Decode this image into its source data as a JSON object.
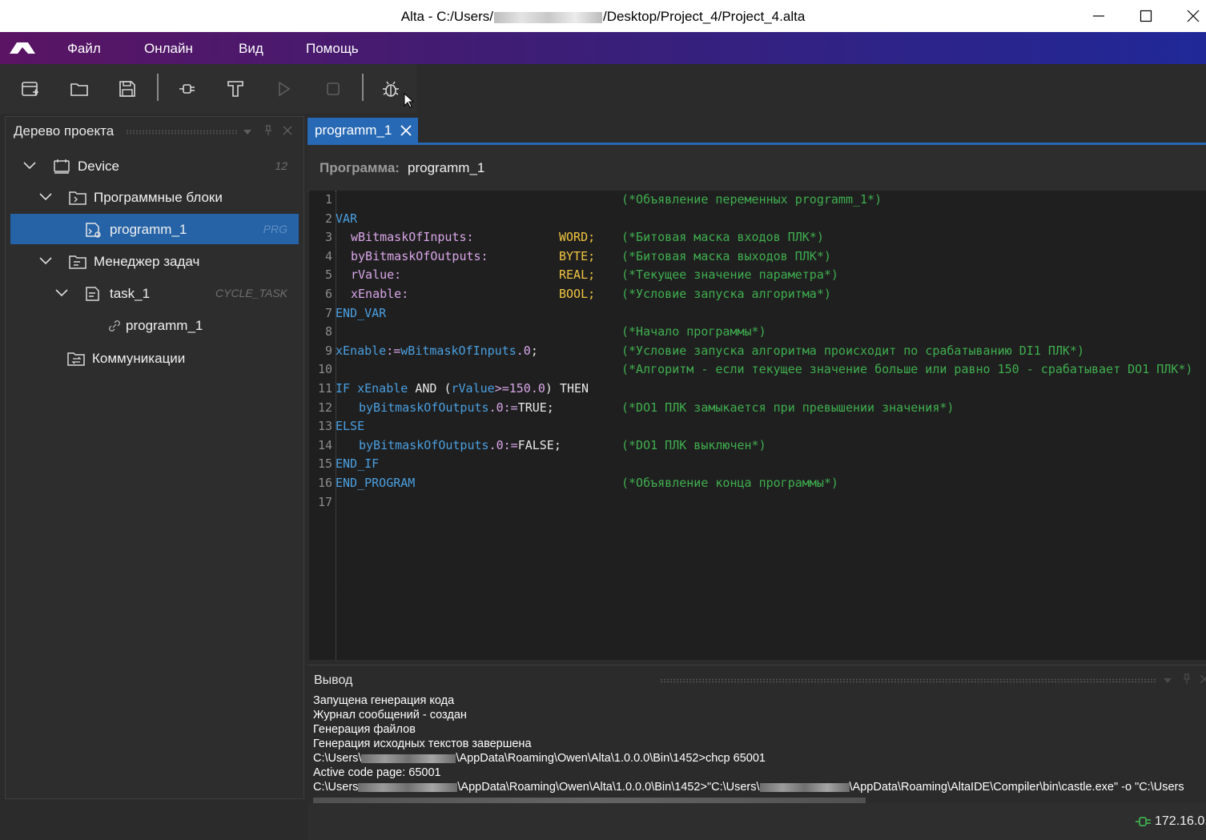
{
  "window": {
    "title_prefix": "Alta - C:/Users/",
    "title_suffix": "/Desktop/Project_4/Project_4.alta",
    "minimize_icon": "minimize-icon",
    "maximize_icon": "maximize-icon",
    "close_icon": "close-icon"
  },
  "menu": {
    "logo": "alta-logo",
    "items": [
      "Файл",
      "Онлайн",
      "Вид",
      "Помощь"
    ]
  },
  "toolbar": {
    "icons": [
      "new-project-icon",
      "open-folder-icon",
      "save-icon",
      "connect-plug-icon",
      "build-hammer-icon",
      "run-icon",
      "stop-icon",
      "debug-bug-icon"
    ]
  },
  "project_tree": {
    "title": "Дерево проекта",
    "nodes": [
      {
        "label": "Device",
        "badge": "12"
      },
      {
        "label": "Программные блоки",
        "badge": ""
      },
      {
        "label": "programm_1",
        "badge": "PRG"
      },
      {
        "label": "Менеджер задач",
        "badge": ""
      },
      {
        "label": "task_1",
        "badge": "CYCLE_TASK"
      },
      {
        "label": "programm_1",
        "badge": ""
      },
      {
        "label": "Коммуникации",
        "badge": ""
      }
    ]
  },
  "editor": {
    "tab_label": "programm_1",
    "header_prefix": "Программа:",
    "header_name": "programm_1",
    "line_numbers": [
      "1",
      "2",
      "3",
      "4",
      "5",
      "6",
      "7",
      "8",
      "9",
      "10",
      "11",
      "12",
      "13",
      "14",
      "15",
      "16",
      "17"
    ],
    "code": {
      "l1_comment": "(*Объявление переменных programm_1*)",
      "l2": "VAR",
      "l3_var": "wBitmaskOfInputs:",
      "l3_type": "WORD;",
      "l3_comment": "(*Битовая маска входов ПЛК*)",
      "l4_var": "byBitmaskOfOutputs:",
      "l4_type": "BYTE;",
      "l4_comment": "(*Битовая маска выходов ПЛК*)",
      "l5_var": "rValue:",
      "l5_type": "REAL;",
      "l5_comment": "(*Текущее значение параметра*)",
      "l6_var": "xEnable:",
      "l6_type": "BOOL;",
      "l6_comment": "(*Условие запуска алгоритма*)",
      "l7": "END_VAR",
      "l8_comment": "(*Начало программы*)",
      "l9_a": "xEnable",
      "l9_b": ":=",
      "l9_c": "wBitmaskOfInputs",
      "l9_d": ".0",
      "l9_e": ";",
      "l9_comment": "(*Условие запуска алгоритма происходит по срабатыванию DI1 ПЛК*)",
      "l10_comment": "(*Алгоритм - если текущее значение больше или равно 150 - срабатывает DO1 ПЛК*)",
      "l11_if": "IF",
      "l11_x": "xEnable",
      "l11_and": "AND",
      "l11_p": "(",
      "l11_r": "rValue",
      "l11_ge": ">=",
      "l11_n": "150.0",
      "l11_pc": ")",
      "l11_then": "THEN",
      "l12_a": "byBitmaskOfOutputs",
      "l12_b": ".0",
      "l12_c": ":=",
      "l12_d": "TRUE;",
      "l12_comment": "(*DO1 ПЛК замыкается при превышении значения*)",
      "l13": "ELSE",
      "l14_a": "byBitmaskOfOutputs",
      "l14_b": ".0",
      "l14_c": ":=",
      "l14_d": "FALSE;",
      "l14_comment": "(*DO1 ПЛК выключен*)",
      "l15": "END_IF",
      "l16": "END_PROGRAM",
      "l16_comment": "(*Объявление конца программы*)"
    }
  },
  "output": {
    "title": "Вывод",
    "lines": [
      "Запущена генерация кода",
      "Журнал сообщений - создан",
      "Генерация файлов",
      "Генерация исходных текстов завершена"
    ],
    "cmd1_prefix": "C:\\Users\\",
    "cmd1_suffix": "\\AppData\\Roaming\\Owen\\Alta\\1.0.0.0\\Bin\\1452>chcp 65001",
    "code_page": "Active code page: 65001",
    "cmd2_prefix": "C:\\Users",
    "cmd2_mid": "\\AppData\\Roaming\\Owen\\Alta\\1.0.0.0\\Bin\\1452>\"C:\\Users\\",
    "cmd2_suffix": "\\AppData\\Roaming\\AltaIDE\\Compiler\\bin\\castle.exe\" -o \"C:\\Users"
  },
  "status": {
    "ip": "172.16.0.",
    "connection_icon": "connection-plug-icon",
    "accent": "#3fae4f"
  },
  "colors": {
    "accent_blue": "#2769b5",
    "keyword": "#4a9fe0",
    "variable": "#d9a6e8",
    "type": "#f0c541",
    "comment": "#3fae4f"
  }
}
